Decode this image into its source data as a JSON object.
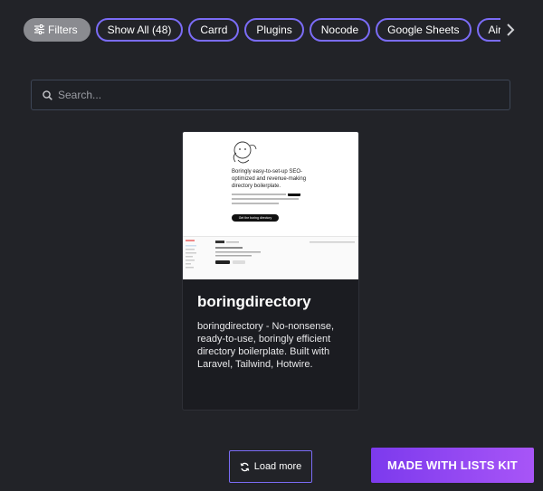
{
  "filters": {
    "filters_label": "Filters",
    "chips": [
      "Show All (48)",
      "Carrd",
      "Plugins",
      "Nocode",
      "Google Sheets",
      "Airtable"
    ]
  },
  "search": {
    "placeholder": "Search..."
  },
  "card": {
    "title": "boringdirectory",
    "description": "boringdirectory - No-nonsense, ready-to-use, boringly efficient directory boilerplate. Built with Laravel, Tailwind, Hotwire.",
    "thumbnail": {
      "headline": "Boringly easy-to-set-up SEO-optimized and revenue-making directory boilerplate.",
      "cta": "Get the boring directory"
    }
  },
  "load_more": {
    "label": "Load more"
  },
  "badge": {
    "label": "MADE WITH LISTS KIT"
  },
  "colors": {
    "background": "#222328",
    "chip_border": "#7b6cf6",
    "badge_gradient_start": "#7c3aed",
    "badge_gradient_end": "#a855f7"
  }
}
